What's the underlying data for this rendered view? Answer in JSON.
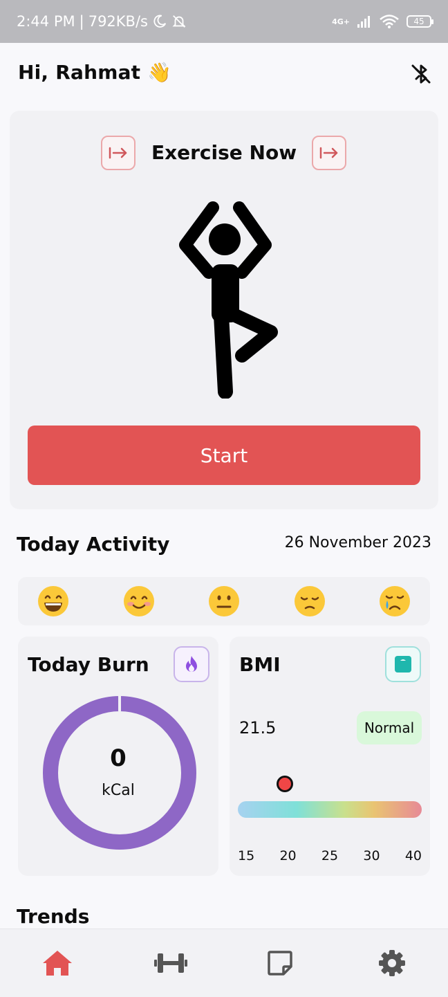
{
  "status_bar": {
    "time": "2:44 PM",
    "speed": "792KB/s",
    "network": "4G+",
    "battery": "45"
  },
  "header": {
    "greeting": "Hi, Rahmat 👋"
  },
  "exercise": {
    "title": "Exercise Now",
    "start_label": "Start"
  },
  "activity": {
    "title": "Today Activity",
    "date": "26 November 2023",
    "moods": [
      "😄",
      "😊",
      "😐",
      "😔",
      "😢"
    ]
  },
  "burn": {
    "title": "Today Burn",
    "value": "0",
    "unit": "kCal"
  },
  "bmi": {
    "title": "BMI",
    "value": "21.5",
    "status": "Normal",
    "scale_ticks": [
      "15",
      "20",
      "25",
      "30",
      "40"
    ]
  },
  "trends": {
    "title": "Trends"
  },
  "colors": {
    "accent": "#e25454",
    "burn": "#8e67c6",
    "bmi_icon": "#1fb7ad",
    "normal_badge": "#d9f8da"
  },
  "nav": {
    "items": [
      "home-icon",
      "dumbbell-icon",
      "notes-icon",
      "gear-icon"
    ],
    "active": "home-icon"
  }
}
